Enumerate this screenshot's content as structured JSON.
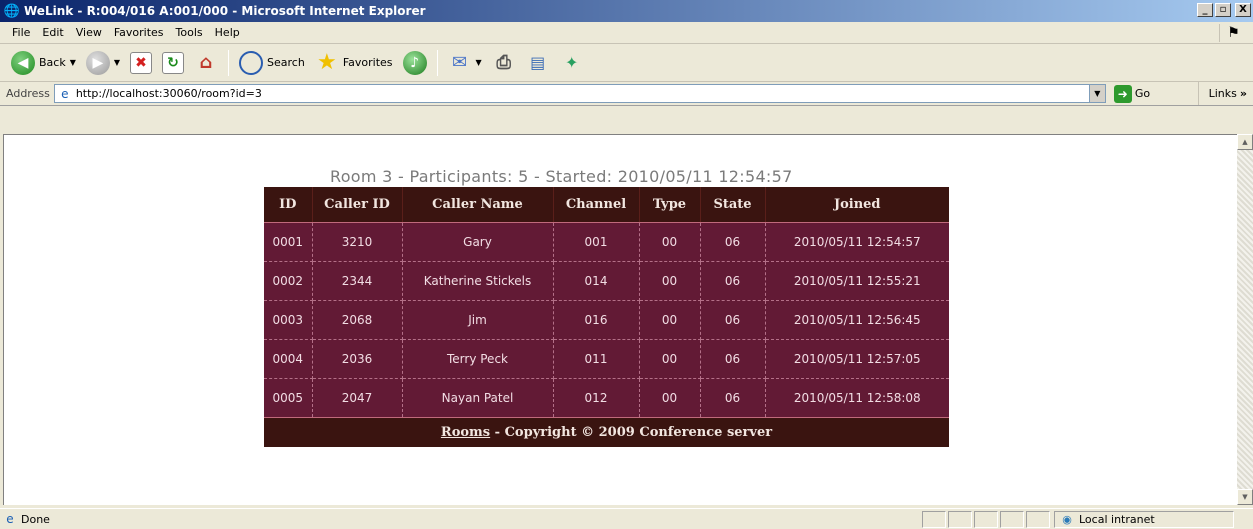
{
  "window": {
    "title": "WeLink - R:004/016 A:001/000 - Microsoft Internet Explorer",
    "btn_min": "_",
    "btn_max": " ",
    "btn_close": "X"
  },
  "menu": [
    "File",
    "Edit",
    "View",
    "Favorites",
    "Tools",
    "Help"
  ],
  "toolbar": {
    "back_label": "Back",
    "search_label": "Search",
    "favorites_label": "Favorites"
  },
  "address": {
    "label": "Address",
    "url": "http://localhost:30060/room?id=3",
    "go_label": "Go",
    "links_label": "Links"
  },
  "room": {
    "title": "Room 3 - Participants: 5 - Started: 2010/05/11 12:54:57",
    "columns": [
      "ID",
      "Caller ID",
      "Caller Name",
      "Channel",
      "Type",
      "State",
      "Joined"
    ],
    "rows": [
      [
        "0001",
        "3210",
        "Gary",
        "001",
        "00",
        "06",
        "2010/05/11 12:54:57"
      ],
      [
        "0002",
        "2344",
        "Katherine Stickels",
        "014",
        "00",
        "06",
        "2010/05/11 12:55:21"
      ],
      [
        "0003",
        "2068",
        "Jim",
        "016",
        "00",
        "06",
        "2010/05/11 12:56:45"
      ],
      [
        "0004",
        "2036",
        "Terry Peck",
        "011",
        "00",
        "06",
        "2010/05/11 12:57:05"
      ],
      [
        "0005",
        "2047",
        "Nayan Patel",
        "012",
        "00",
        "06",
        "2010/05/11 12:58:08"
      ]
    ],
    "footer_link": "Rooms",
    "footer_text": " - Copyright © 2009 Conference server"
  },
  "status": {
    "text": "Done",
    "zone": "Local intranet"
  },
  "colors": {
    "header_bg": "#3a1410",
    "row_bg": "#621a35",
    "title_color": "#7a7a7a"
  }
}
